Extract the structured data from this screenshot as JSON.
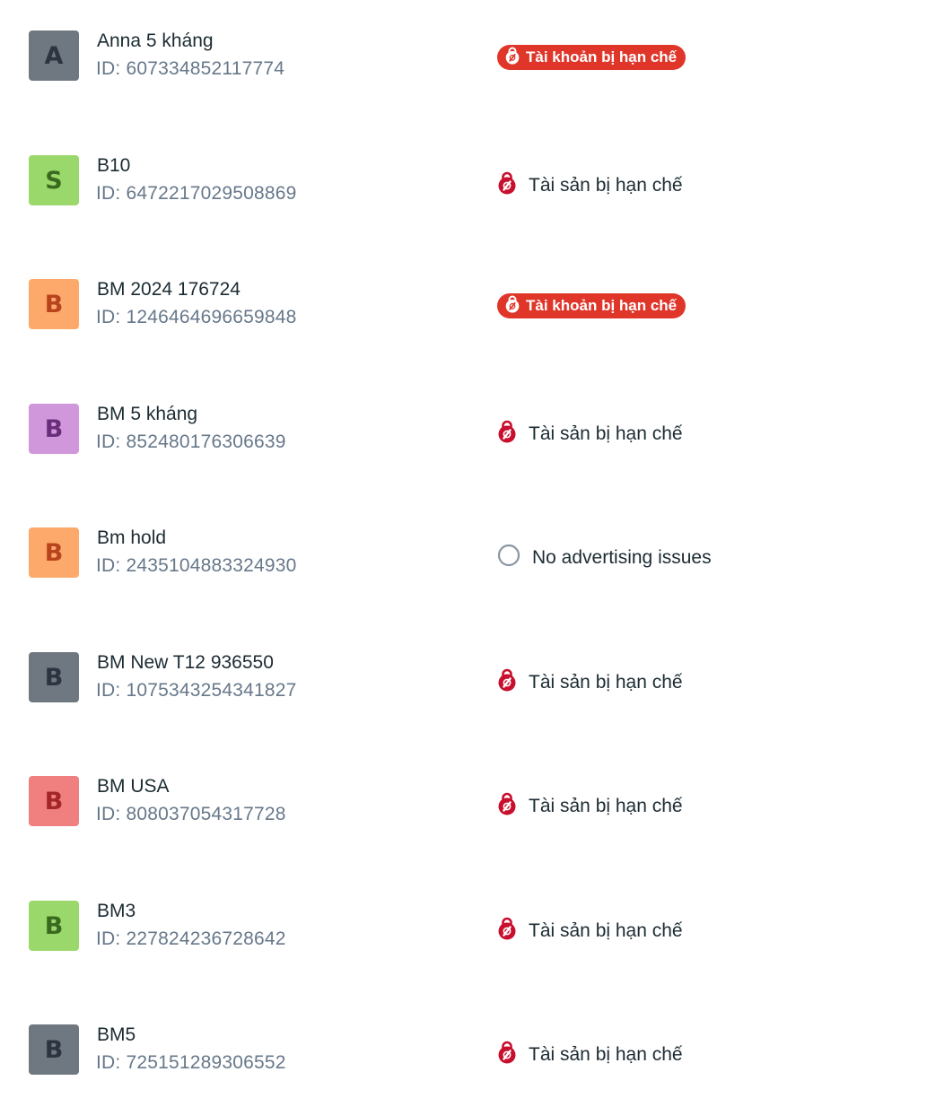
{
  "accounts": [
    {
      "name": "Anna 5 kháng",
      "id_text": "ID: 607334852117774",
      "avatar_letter": "A",
      "avatar_bg": "#6f7780",
      "avatar_fg": "#2b3440",
      "status_kind": "pill",
      "status_text": "Tài khoản bị hạn chế"
    },
    {
      "name": "B10",
      "id_text": "ID: 6472217029508869",
      "avatar_letter": "S",
      "avatar_bg": "#9bd86b",
      "avatar_fg": "#3a6a20",
      "status_kind": "restricted",
      "status_text": "Tài sản bị hạn chế"
    },
    {
      "name": "BM 2024 176724",
      "id_text": "ID: 1246464696659848",
      "avatar_letter": "B",
      "avatar_bg": "#fda96b",
      "avatar_fg": "#b8431c",
      "status_kind": "pill",
      "status_text": "Tài khoản bị hạn chế"
    },
    {
      "name": "BM 5 kháng",
      "id_text": "ID: 852480176306639",
      "avatar_letter": "B",
      "avatar_bg": "#d197db",
      "avatar_fg": "#6a2d7c",
      "status_kind": "restricted",
      "status_text": "Tài sản bị hạn chế"
    },
    {
      "name": "Bm hold",
      "id_text": "ID: 2435104883324930",
      "avatar_letter": "B",
      "avatar_bg": "#fda96b",
      "avatar_fg": "#b8431c",
      "status_kind": "ok",
      "status_text": "No advertising issues"
    },
    {
      "name": "BM New T12 936550",
      "id_text": "ID: 1075343254341827",
      "avatar_letter": "B",
      "avatar_bg": "#6f7780",
      "avatar_fg": "#2b3440",
      "status_kind": "restricted",
      "status_text": "Tài sản bị hạn chế"
    },
    {
      "name": "BM USA",
      "id_text": "ID: 808037054317728",
      "avatar_letter": "B",
      "avatar_bg": "#f08080",
      "avatar_fg": "#a42626",
      "status_kind": "restricted",
      "status_text": "Tài sản bị hạn chế"
    },
    {
      "name": "BM3",
      "id_text": "ID: 227824236728642",
      "avatar_letter": "B",
      "avatar_bg": "#9bd86b",
      "avatar_fg": "#3a6a20",
      "status_kind": "restricted",
      "status_text": "Tài sản bị hạn chế"
    },
    {
      "name": "BM5",
      "id_text": "ID: 725151289306552",
      "avatar_letter": "B",
      "avatar_bg": "#6f7780",
      "avatar_fg": "#2b3440",
      "status_kind": "restricted",
      "status_text": "Tài sản bị hạn chế"
    }
  ],
  "icons": {
    "pill": "restricted-account-icon",
    "restricted": "restricted-asset-icon",
    "ok": "no-issues-circle-icon"
  },
  "colors": {
    "pill_bg": "#e0362a",
    "restricted_icon": "#c8102e",
    "ok_ring": "#8a96a3",
    "id_text": "#67788a"
  }
}
